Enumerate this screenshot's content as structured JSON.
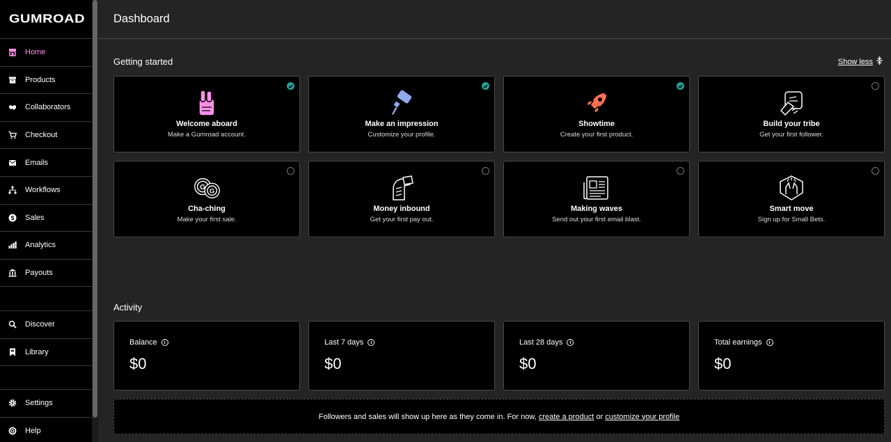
{
  "brand": "gumroad",
  "sidebar": {
    "items": [
      {
        "label": "Home",
        "icon": "shop-icon"
      },
      {
        "label": "Products",
        "icon": "archive-icon"
      },
      {
        "label": "Collaborators",
        "icon": "handshake-icon"
      },
      {
        "label": "Checkout",
        "icon": "cart-icon"
      },
      {
        "label": "Emails",
        "icon": "envelope-icon"
      },
      {
        "label": "Workflows",
        "icon": "diagram-icon"
      },
      {
        "label": "Sales",
        "icon": "dollar-circle-icon"
      },
      {
        "label": "Analytics",
        "icon": "bar-chart-icon"
      },
      {
        "label": "Payouts",
        "icon": "bank-icon"
      }
    ],
    "secondary": [
      {
        "label": "Discover",
        "icon": "search-icon"
      },
      {
        "label": "Library",
        "icon": "bookmark-icon"
      }
    ],
    "bottom": [
      {
        "label": "Settings",
        "icon": "gear-icon"
      },
      {
        "label": "Help",
        "icon": "help-circle-icon"
      }
    ]
  },
  "header": {
    "title": "Dashboard"
  },
  "getting_started": {
    "title": "Getting started",
    "toggle_label": "Show less",
    "cards": [
      {
        "title": "Welcome aboard",
        "subtitle": "Make a Gumroad account.",
        "done": true
      },
      {
        "title": "Make an impression",
        "subtitle": "Customize your profile.",
        "done": true
      },
      {
        "title": "Showtime",
        "subtitle": "Create your first product.",
        "done": true
      },
      {
        "title": "Build your tribe",
        "subtitle": "Get your first follower.",
        "done": false
      },
      {
        "title": "Cha-ching",
        "subtitle": "Make your first sale.",
        "done": false
      },
      {
        "title": "Money inbound",
        "subtitle": "Get your first pay out.",
        "done": false
      },
      {
        "title": "Making waves",
        "subtitle": "Send out your first email blast.",
        "done": false
      },
      {
        "title": "Smart move",
        "subtitle": "Sign up for Small Bets.",
        "done": false
      }
    ]
  },
  "activity": {
    "title": "Activity",
    "stats": [
      {
        "label": "Balance",
        "value": "$0"
      },
      {
        "label": "Last 7 days",
        "value": "$0"
      },
      {
        "label": "Last 28 days",
        "value": "$0"
      },
      {
        "label": "Total earnings",
        "value": "$0"
      }
    ],
    "empty_text": "Followers and sales will show up here as they come in. For now,",
    "link1": "create a product",
    "link_joiner": "or",
    "link2": "customize your profile"
  },
  "colors": {
    "accent": "#ff90e8",
    "check": "#23a094",
    "background": "#242424"
  }
}
